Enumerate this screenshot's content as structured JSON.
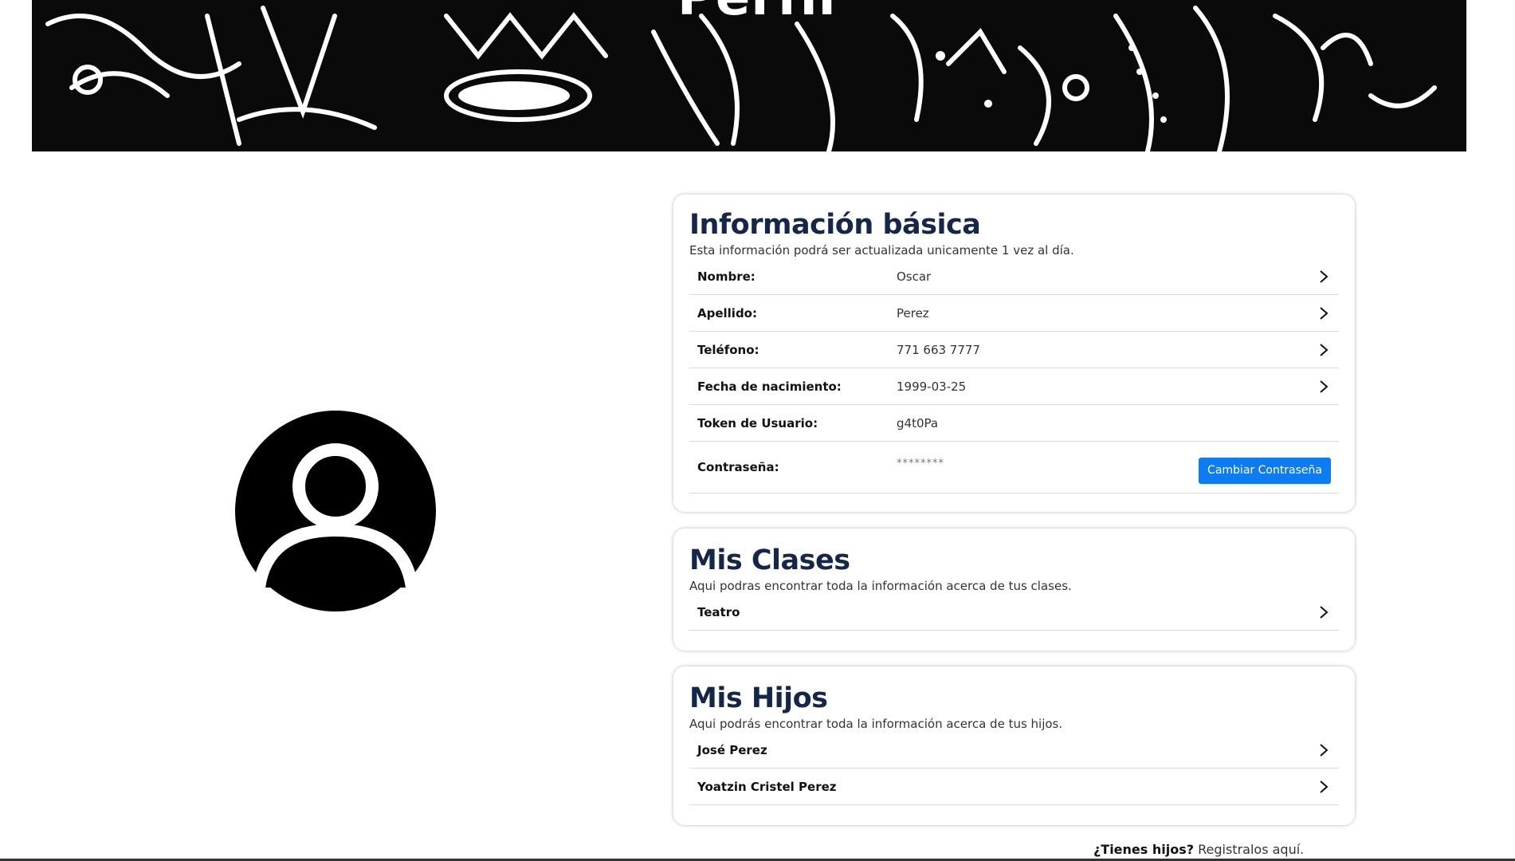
{
  "banner": {
    "title": "Perfil"
  },
  "avatar": {
    "icon": "user-avatar-icon"
  },
  "basic_info": {
    "title": "Información básica",
    "subtitle": "Esta información podrá ser actualizada unicamente 1 vez al día.",
    "rows": [
      {
        "label": "Nombre:",
        "value": "Oscar"
      },
      {
        "label": "Apellido:",
        "value": "Perez"
      },
      {
        "label": "Teléfono:",
        "value": "771 663 7777"
      },
      {
        "label": "Fecha de nacimiento:",
        "value": "1999-03-25"
      },
      {
        "label": "Token de Usuario:",
        "value": "g4t0Pa"
      }
    ],
    "password": {
      "label": "Contraseña:",
      "value": "********",
      "button_label": "Cambiar Contraseña"
    }
  },
  "classes": {
    "title": "Mis Clases",
    "subtitle": "Aqui podras encontrar toda la información acerca de tus clases.",
    "items": [
      {
        "label": "Teatro"
      }
    ]
  },
  "children": {
    "title": "Mis Hijos",
    "subtitle": "Aqui podrás encontrar toda la información acerca de tus hijos.",
    "items": [
      {
        "label": "José Perez"
      },
      {
        "label": "Yoatzin Cristel Perez"
      }
    ]
  },
  "footer": {
    "question": "¿Tienes hijos?",
    "link": "Registralos aquí."
  },
  "colors": {
    "heading": "#14264a",
    "primary_button": "#0d7cf2"
  }
}
